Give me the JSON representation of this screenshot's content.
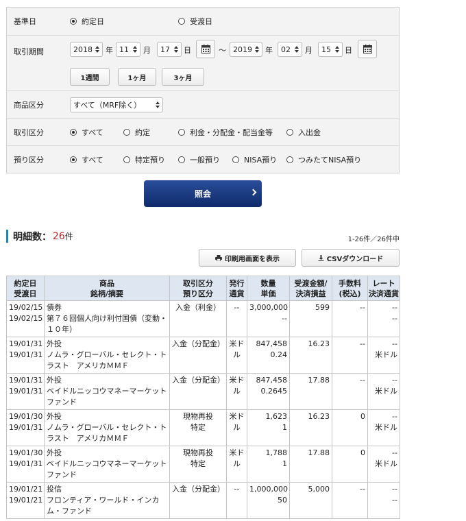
{
  "form": {
    "base_date": {
      "label": "基準日",
      "options": [
        {
          "label": "約定日",
          "selected": true
        },
        {
          "label": "受渡日",
          "selected": false
        }
      ]
    },
    "period": {
      "label": "取引期間",
      "from": {
        "year": "2018",
        "month": "11",
        "day": "17"
      },
      "to": {
        "year": "2019",
        "month": "02",
        "day": "15"
      },
      "unit_year": "年",
      "unit_month": "月",
      "unit_day": "日",
      "separator": "～",
      "presets": [
        "1週間",
        "1ヶ月",
        "3ヶ月"
      ]
    },
    "product": {
      "label": "商品区分",
      "selected": "すべて（MRF除く）"
    },
    "trade_type": {
      "label": "取引区分",
      "options": [
        {
          "label": "すべて",
          "selected": true
        },
        {
          "label": "約定",
          "selected": false
        },
        {
          "label": "利金・分配金・配当金等",
          "selected": false
        },
        {
          "label": "入出金",
          "selected": false
        }
      ]
    },
    "custody": {
      "label": "預り区分",
      "options": [
        {
          "label": "すべて",
          "selected": true
        },
        {
          "label": "特定預り",
          "selected": false
        },
        {
          "label": "一般預り",
          "selected": false
        },
        {
          "label": "NISA預り",
          "selected": false
        },
        {
          "label": "つみたてNISA預り",
          "selected": false
        }
      ]
    },
    "submit_label": "照会"
  },
  "results": {
    "title": "明細数：",
    "count": "26",
    "count_unit": "件",
    "range": "1-26件／26件中",
    "print_label": "印刷用画面を表示",
    "csv_label": "CSVダウンロード",
    "columns": [
      [
        "約定日",
        "受渡日"
      ],
      [
        "商品",
        "銘柄/摘要"
      ],
      [
        "取引区分",
        "預り区分"
      ],
      [
        "発行",
        "通貨"
      ],
      [
        "数量",
        "単価"
      ],
      [
        "受渡金額/",
        "決済損益"
      ],
      [
        "手数料",
        "(税込)"
      ],
      [
        "レート",
        "決済通貨"
      ]
    ],
    "rows": [
      {
        "trade_date": "19/02/15",
        "settle_date": "19/02/15",
        "product": "債券",
        "name": "第７６回個人向け利付国債（変動・１０年）",
        "trade_type": "入金（利金）",
        "custody": "",
        "currency": "--",
        "qty": "3,000,000",
        "price": "--",
        "amount": "599",
        "fee": "--",
        "rate": "--",
        "settle_ccy": "--"
      },
      {
        "trade_date": "19/01/31",
        "settle_date": "19/01/31",
        "product": "外投",
        "name": "ノムラ・グローバル・セレクト・トラスト　アメリカＭＭＦ",
        "trade_type": "入金（分配金）",
        "custody": "",
        "currency": "米ドル",
        "qty": "847,458",
        "price": "0.24",
        "amount": "16.23",
        "fee": "--",
        "rate": "--",
        "settle_ccy": "米ドル"
      },
      {
        "trade_date": "19/01/31",
        "settle_date": "19/01/31",
        "product": "外投",
        "name": "ベイドルニッコウマネーマーケットファンド",
        "trade_type": "入金（分配金）",
        "custody": "",
        "currency": "米ドル",
        "qty": "847,458",
        "price": "0.2645",
        "amount": "17.88",
        "fee": "--",
        "rate": "--",
        "settle_ccy": "米ドル"
      },
      {
        "trade_date": "19/01/30",
        "settle_date": "19/01/31",
        "product": "外投",
        "name": "ノムラ・グローバル・セレクト・トラスト　アメリカＭＭＦ",
        "trade_type": "現物再投",
        "custody": "特定",
        "currency": "米ドル",
        "qty": "1,623",
        "price": "1",
        "amount": "16.23",
        "fee": "0",
        "rate": "--",
        "settle_ccy": "米ドル"
      },
      {
        "trade_date": "19/01/30",
        "settle_date": "19/01/31",
        "product": "外投",
        "name": "ベイドルニッコウマネーマーケットファンド",
        "trade_type": "現物再投",
        "custody": "特定",
        "currency": "米ドル",
        "qty": "1,788",
        "price": "1",
        "amount": "17.88",
        "fee": "0",
        "rate": "--",
        "settle_ccy": "米ドル"
      },
      {
        "trade_date": "19/01/21",
        "settle_date": "19/01/21",
        "product": "投信",
        "name": "フロンティア・ワールド・インカム・ファンド",
        "trade_type": "入金（分配金）",
        "custody": "",
        "currency": "--",
        "qty": "1,000,000",
        "price": "50",
        "amount": "5,000",
        "fee": "--",
        "rate": "--",
        "settle_ccy": "--"
      }
    ]
  }
}
